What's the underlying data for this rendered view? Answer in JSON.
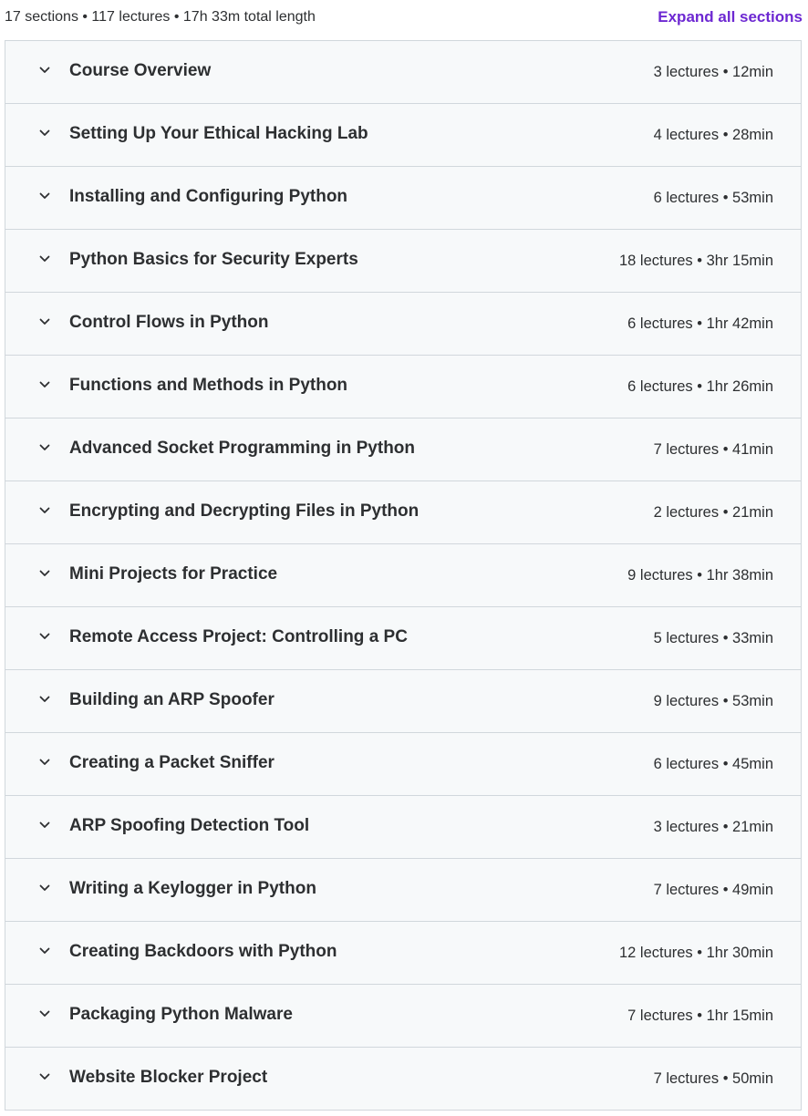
{
  "summary": {
    "text": "17 sections • 117 lectures • 17h 33m total length",
    "expand_label": "Expand all sections"
  },
  "icons": {
    "section_toggle": "chevron-down-icon"
  },
  "colors": {
    "accent": "#6d28d2",
    "row_background": "#f7f9fa",
    "border": "#d1d7dc",
    "text": "#2d2f31"
  },
  "sections": [
    {
      "title": "Course Overview",
      "meta": "3 lectures • 12min"
    },
    {
      "title": "Setting Up Your Ethical Hacking Lab",
      "meta": "4 lectures • 28min"
    },
    {
      "title": "Installing and Configuring Python",
      "meta": "6 lectures • 53min"
    },
    {
      "title": "Python Basics for Security Experts",
      "meta": "18 lectures • 3hr 15min"
    },
    {
      "title": "Control Flows in Python",
      "meta": "6 lectures • 1hr 42min"
    },
    {
      "title": "Functions and Methods in Python",
      "meta": "6 lectures • 1hr 26min"
    },
    {
      "title": "Advanced Socket Programming in Python",
      "meta": "7 lectures • 41min"
    },
    {
      "title": "Encrypting and Decrypting Files in Python",
      "meta": "2 lectures • 21min"
    },
    {
      "title": "Mini Projects for Practice",
      "meta": "9 lectures • 1hr 38min"
    },
    {
      "title": "Remote Access Project: Controlling a PC",
      "meta": "5 lectures • 33min"
    },
    {
      "title": "Building an ARP Spoofer",
      "meta": "9 lectures • 53min"
    },
    {
      "title": "Creating a Packet Sniffer",
      "meta": "6 lectures • 45min"
    },
    {
      "title": "ARP Spoofing Detection Tool",
      "meta": "3 lectures • 21min"
    },
    {
      "title": "Writing a Keylogger in Python",
      "meta": "7 lectures • 49min"
    },
    {
      "title": "Creating Backdoors with Python",
      "meta": "12 lectures • 1hr 30min"
    },
    {
      "title": "Packaging Python Malware",
      "meta": "7 lectures • 1hr 15min"
    },
    {
      "title": "Website Blocker Project",
      "meta": "7 lectures • 50min"
    }
  ]
}
